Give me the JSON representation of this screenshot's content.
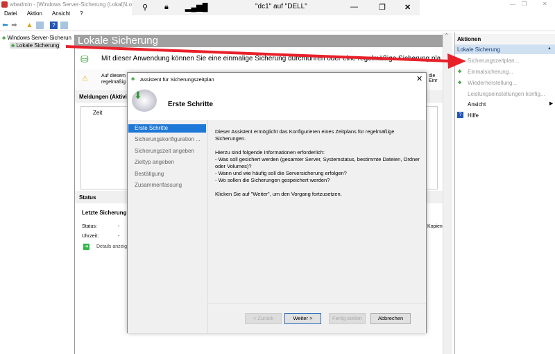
{
  "window": {
    "title": "wbadmin - [Windows Server-Sicherung (Lokal)\\Lokale Sicherung]",
    "title_visible": "wbadmin - [Windows Server-Sicherung (Lokal)\\Loka"
  },
  "remote_bar": {
    "title": "\"dc1\" auf \"DELL\"",
    "close": "✕"
  },
  "menu": [
    "Datei",
    "Aktion",
    "Ansicht",
    "?"
  ],
  "tree": {
    "root": "Windows Server-Sicherun",
    "child": "Lokale Sicherung"
  },
  "center": {
    "header": "Lokale Sicherung",
    "intro": "Mit dieser Anwendung können Sie eine einmalige Sicherung durchführen oder eine regelmäßige Sicherung pla",
    "warning_line1": "Auf diesem",
    "warning_line2": "regelmäßig",
    "warning_right": "die Einr",
    "messages_header": "Meldungen (Aktivit",
    "col_time": "Zeit",
    "status_header": "Status",
    "last_backup": "Letzte Sicherung",
    "status_label": "Status:",
    "status_value": "-",
    "time_label": "Uhrzeit:",
    "time_value": "-",
    "details_link": "Details anzeig",
    "copies_text": "Kopien"
  },
  "actions": {
    "header": "Aktionen",
    "section": "Lokale Sicherung",
    "items": [
      "Sicherungszeitplan...",
      "Einmalsicherung...",
      "Wiederherstellung...",
      "Leistungseinstellungen konfig...",
      "Ansicht",
      "Hilfe"
    ]
  },
  "dialog": {
    "title": "Assistent für Sicherungszeitplan",
    "heading": "Erste Schritte",
    "steps": [
      "Erste Schritte",
      "Sicherungskonfiguration ...",
      "Sicherungszeit angeben",
      "Zieltyp angeben",
      "Bestätigung",
      "Zusammenfassung"
    ],
    "body": "Dieser Assistent ermöglicht das Konfigurieren eines Zeitplans für regelmäßige Sicherungen.\n\nHierzu sind folgende Informationen erforderlich:\n- Was soll gesichert werden (gesamter Server, Systemstatus, bestimmte Dateien, Ordner oder Volumes)?\n- Wann und wie häufig soll die Serversicherung erfolgen?\n- Wo sollen die Sicherungen gespeichert werden?\n\nKlicken Sie auf \"Weiter\", um den Vorgang fortzusetzen.",
    "buttons": {
      "back": "< Zurück",
      "next": "Weiter >",
      "finish": "Fertig stellen",
      "cancel": "Abbrechen"
    }
  },
  "colors": {
    "accent": "#1e78d7",
    "header_gray": "#a0a0a0",
    "arrow": "#e8202a",
    "section_bg": "#cfe0f1"
  }
}
